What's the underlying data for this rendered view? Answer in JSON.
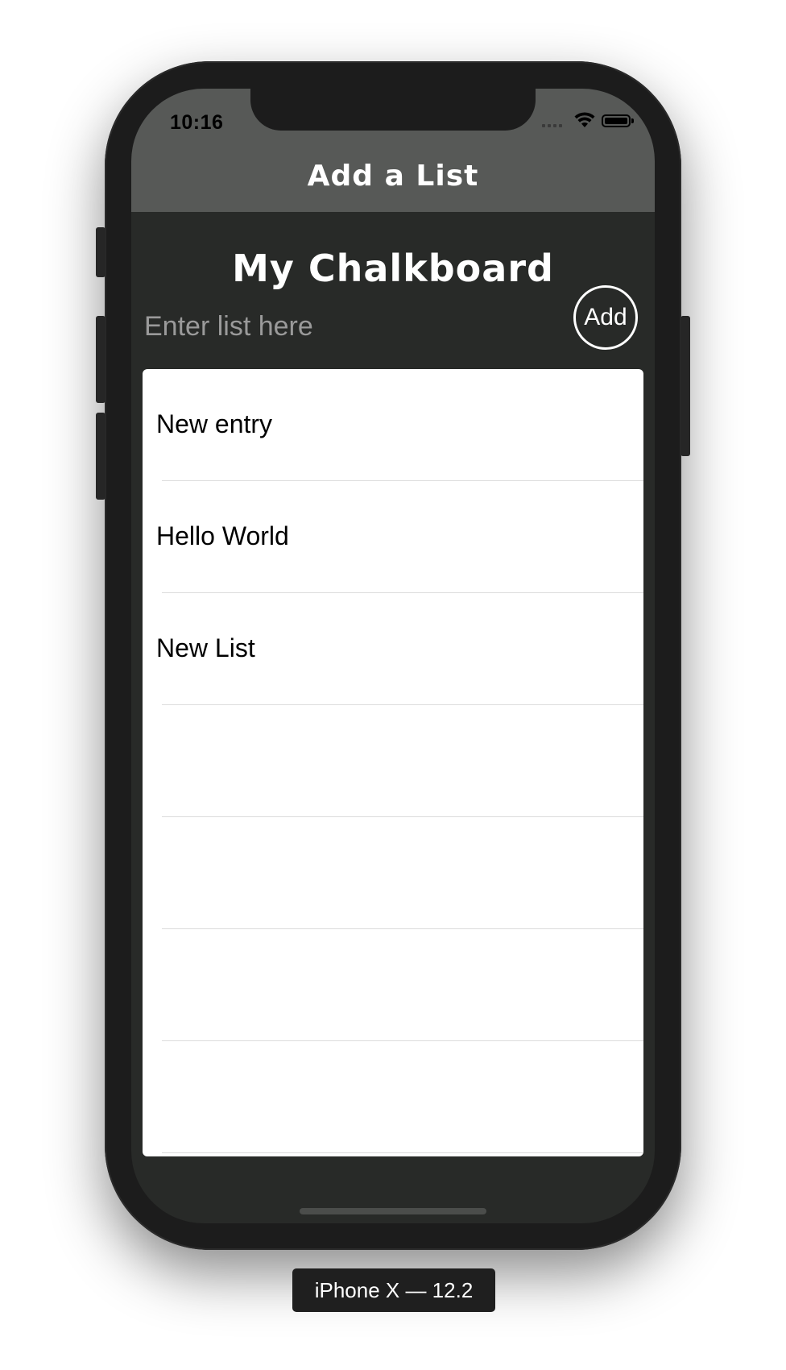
{
  "status_bar": {
    "time": "10:16"
  },
  "navbar": {
    "title": "Add a List"
  },
  "board": {
    "title": "My Chalkboard",
    "input_placeholder": "Enter list here",
    "input_value": "",
    "add_label": "Add"
  },
  "lists": [
    {
      "label": "New entry"
    },
    {
      "label": "Hello World"
    },
    {
      "label": "New List"
    },
    {
      "label": ""
    },
    {
      "label": ""
    },
    {
      "label": ""
    },
    {
      "label": ""
    }
  ],
  "simulator": {
    "device_label": "iPhone X — 12.2"
  },
  "colors": {
    "navbar": "#575957",
    "board_background": "#282a28",
    "accent_text": "#ffffff"
  }
}
